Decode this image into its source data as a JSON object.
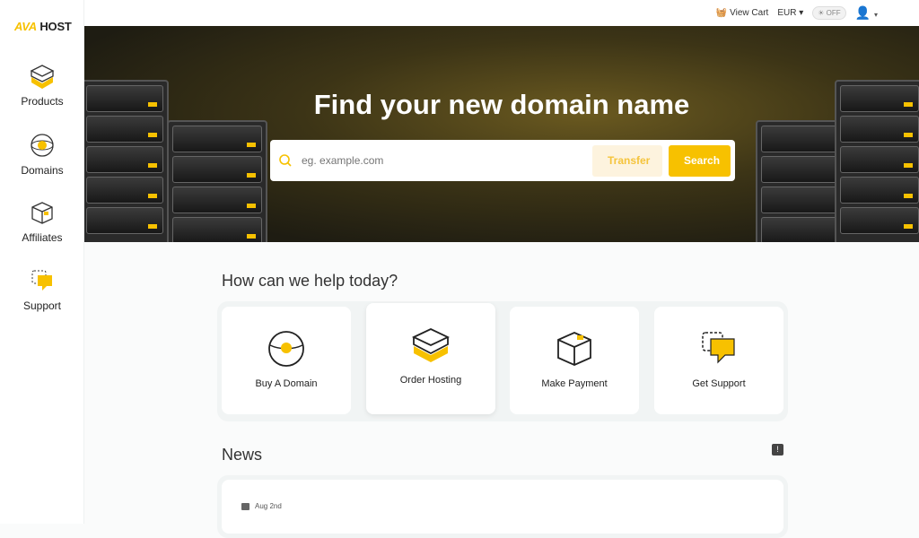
{
  "brand": {
    "part1": "AVA",
    "part2": "HOST"
  },
  "sidebar": {
    "items": [
      {
        "label": "Products"
      },
      {
        "label": "Domains"
      },
      {
        "label": "Affiliates"
      },
      {
        "label": "Support"
      }
    ]
  },
  "topbar": {
    "cart": "View Cart",
    "currency": "EUR",
    "theme_toggle": "OFF"
  },
  "hero": {
    "title": "Find your new domain name",
    "search_placeholder": "eg. example.com",
    "transfer": "Transfer",
    "search": "Search"
  },
  "help": {
    "title": "How can we help today?",
    "cards": [
      {
        "label": "Buy A Domain"
      },
      {
        "label": "Order Hosting"
      },
      {
        "label": "Make Payment"
      },
      {
        "label": "Get Support"
      }
    ]
  },
  "news": {
    "title": "News",
    "items": [
      {
        "date": "Aug 2nd"
      }
    ]
  }
}
